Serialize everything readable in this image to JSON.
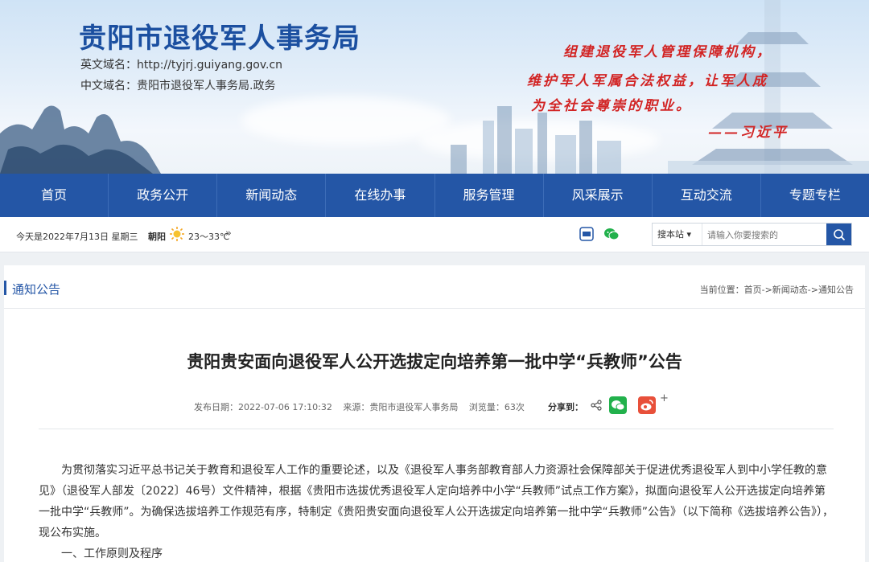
{
  "header": {
    "site_title": "贵阳市退役军人事务局",
    "domain_en": "英文域名：http://tyjrj.guiyang.gov.cn",
    "domain_cn": "中文域名：贵阳市退役军人事务局.政务",
    "quote_line1": "组建退役军人管理保障机构，",
    "quote_line2": "维护军人军属合法权益，让军人成",
    "quote_line3": "为全社会尊崇的职业。",
    "quote_author": "——习近平"
  },
  "nav": {
    "items": [
      "首页",
      "政务公开",
      "新闻动态",
      "在线办事",
      "服务管理",
      "风采展示",
      "互动交流",
      "专题专栏"
    ]
  },
  "infobar": {
    "date": "今天是2022年7月13日 星期三",
    "city": "朝阳",
    "temperature": "23～33℃",
    "more": "»",
    "search_scope": "搜本站 ▾",
    "search_placeholder": "请输入你要搜索的"
  },
  "section": {
    "title": "通知公告",
    "breadcrumb": "当前位置：首页->新闻动态->通知公告"
  },
  "article": {
    "title": "贵阳贵安面向退役军人公开选拔定向培养第一批中学“兵教师”公告",
    "publish_date": "发布日期：2022-07-06 17:10:32",
    "source": "来源：贵阳市退役军人事务局",
    "views": "浏览量：63次",
    "share_label": "分享到：",
    "plus": "+",
    "paragraph1": "为贯彻落实习近平总书记关于教育和退役军人工作的重要论述，以及《退役军人事务部教育部人力资源社会保障部关于促进优秀退役军人到中小学任教的意见》（退役军人部发〔2022〕46号）文件精神，根据《贵阳市选拔优秀退役军人定向培养中小学“兵教师”试点工作方案》，拟面向退役军人公开选拔定向培养第一批中学“兵教师”。为确保选拔培养工作规范有序，特制定《贵阳贵安面向退役军人公开选拔定向培养第一批中学“兵教师”公告》（以下简称《选拔培养公告》），现公布实施。",
    "heading1": "一、工作原则及程序"
  },
  "colors": {
    "nav_bg": "#2456a6",
    "title_blue": "#1b4fa0",
    "quote_red": "#d22424"
  }
}
